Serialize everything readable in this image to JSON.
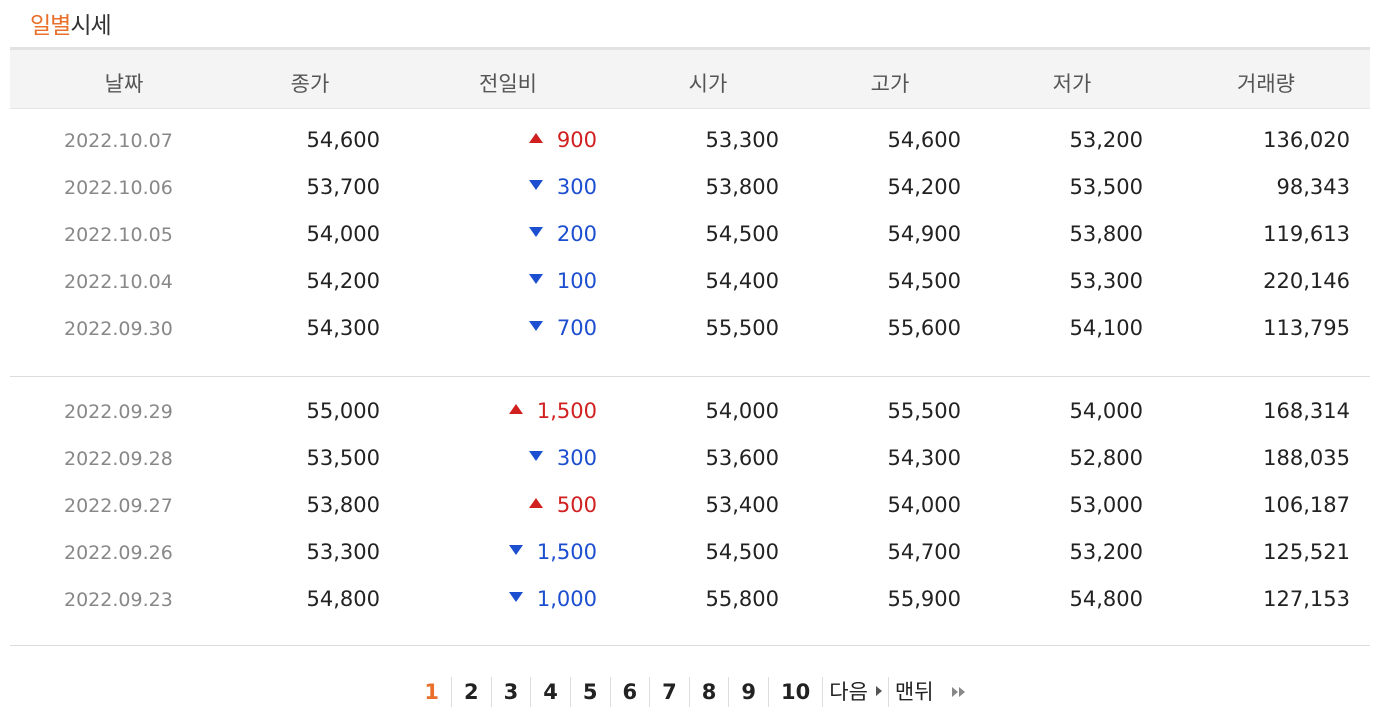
{
  "title": {
    "accent": "일별",
    "rest": "시세"
  },
  "headers": [
    "날짜",
    "종가",
    "전일비",
    "시가",
    "고가",
    "저가",
    "거래량"
  ],
  "groups": [
    [
      {
        "date": "2022.10.07",
        "close": "54,600",
        "dir": "up",
        "diff": "900",
        "open": "53,300",
        "high": "54,600",
        "low": "53,200",
        "vol": "136,020"
      },
      {
        "date": "2022.10.06",
        "close": "53,700",
        "dir": "down",
        "diff": "300",
        "open": "53,800",
        "high": "54,200",
        "low": "53,500",
        "vol": "98,343"
      },
      {
        "date": "2022.10.05",
        "close": "54,000",
        "dir": "down",
        "diff": "200",
        "open": "54,500",
        "high": "54,900",
        "low": "53,800",
        "vol": "119,613"
      },
      {
        "date": "2022.10.04",
        "close": "54,200",
        "dir": "down",
        "diff": "100",
        "open": "54,400",
        "high": "54,500",
        "low": "53,300",
        "vol": "220,146"
      },
      {
        "date": "2022.09.30",
        "close": "54,300",
        "dir": "down",
        "diff": "700",
        "open": "55,500",
        "high": "55,600",
        "low": "54,100",
        "vol": "113,795"
      }
    ],
    [
      {
        "date": "2022.09.29",
        "close": "55,000",
        "dir": "up",
        "diff": "1,500",
        "open": "54,000",
        "high": "55,500",
        "low": "54,000",
        "vol": "168,314"
      },
      {
        "date": "2022.09.28",
        "close": "53,500",
        "dir": "down",
        "diff": "300",
        "open": "53,600",
        "high": "54,300",
        "low": "52,800",
        "vol": "188,035"
      },
      {
        "date": "2022.09.27",
        "close": "53,800",
        "dir": "up",
        "diff": "500",
        "open": "53,400",
        "high": "54,000",
        "low": "53,000",
        "vol": "106,187"
      },
      {
        "date": "2022.09.26",
        "close": "53,300",
        "dir": "down",
        "diff": "1,500",
        "open": "54,500",
        "high": "54,700",
        "low": "53,200",
        "vol": "125,521"
      },
      {
        "date": "2022.09.23",
        "close": "54,800",
        "dir": "down",
        "diff": "1,000",
        "open": "55,800",
        "high": "55,900",
        "low": "54,800",
        "vol": "127,153"
      }
    ]
  ],
  "pagination": {
    "pages": [
      "1",
      "2",
      "3",
      "4",
      "5",
      "6",
      "7",
      "8",
      "9",
      "10"
    ],
    "current": "1",
    "next_label": "다음",
    "last_label": "맨뒤"
  },
  "colors": {
    "accent": "#e8702a",
    "up": "#d0201f",
    "down": "#1c4ed0"
  }
}
